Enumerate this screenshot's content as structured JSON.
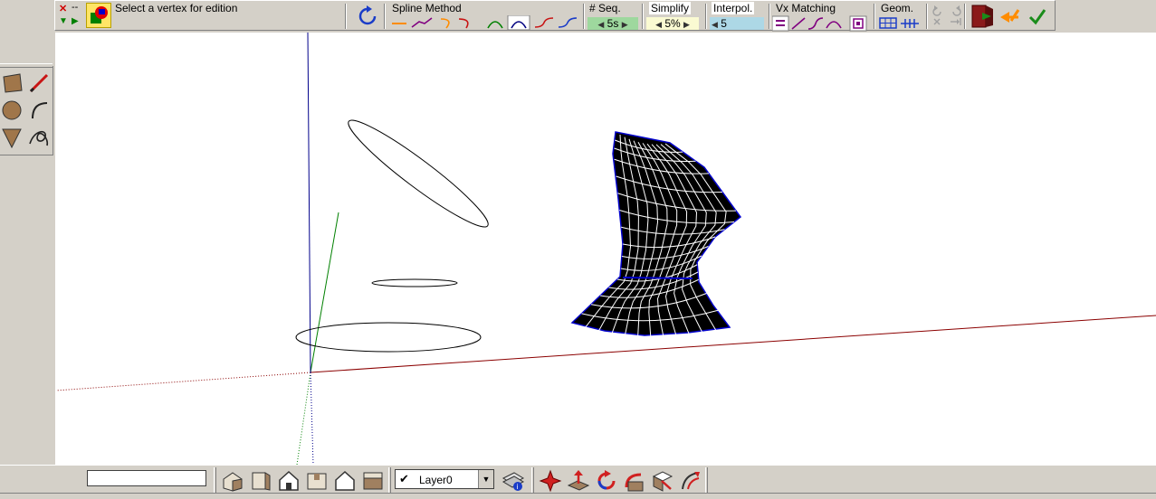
{
  "bezier_toolbar": {
    "status_message": "Select a vertex for edition",
    "spline_method_label": "Spline Method",
    "seq_label": "# Seq.",
    "seq_value": "5s",
    "simplify_label": "Simplify",
    "simplify_value": "5%",
    "interpol_label": "Interpol.",
    "interpol_value": "5",
    "vx_matching_label": "Vx Matching",
    "geom_label": "Geom.",
    "close_glyph": "✕",
    "dash_glyph": "--",
    "colors": {
      "seq_bg": "#9ed89e",
      "simplify_bg": "#fafad2",
      "interpol_bg": "#add8e6",
      "exit_icon": "#8b1a1a",
      "validate_icon": "#1a8c1a",
      "undo_icon": "#ff8c00"
    }
  },
  "drawing_tools": {
    "icons": [
      "rectangle-icon",
      "pencil-icon",
      "circle-icon",
      "arc-icon",
      "polygon-icon",
      "freehand-icon"
    ]
  },
  "bottom_bar": {
    "measurement_value": "",
    "layer_name": "Layer0",
    "layer_check": "✔",
    "view_icons": [
      "iso-view-icon",
      "top-view-icon",
      "front-view-icon",
      "right-view-icon",
      "back-view-icon",
      "left-view-icon"
    ],
    "tool_icons": [
      "orbit-icon",
      "push-pull-icon",
      "rotate-icon",
      "follow-me-icon",
      "scale-icon",
      "offset-icon"
    ]
  },
  "canvas": {
    "axis_colors": {
      "red": "#8b0000",
      "green": "#008000",
      "blue": "#00008b"
    }
  }
}
